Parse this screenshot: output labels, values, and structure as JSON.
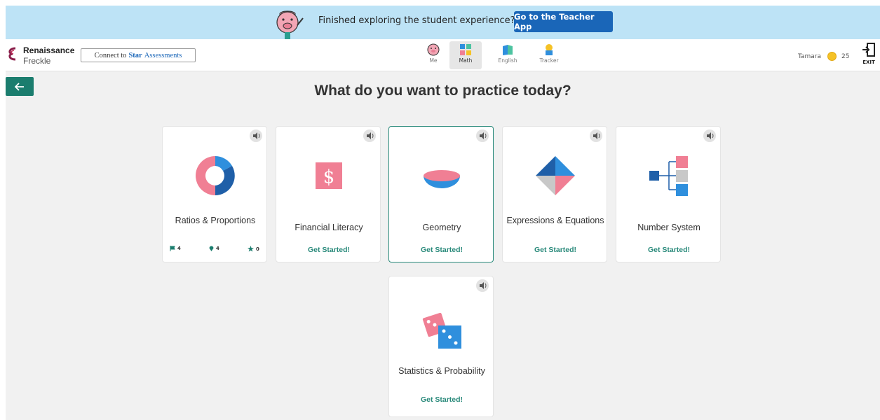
{
  "banner": {
    "message": "Finished exploring the student experience?",
    "button_label": "Go to the Teacher App"
  },
  "brand": {
    "line1": "Renaissance",
    "line2": "Freckle",
    "connect_prefix": "Connect to",
    "connect_star": "Star",
    "connect_suffix": "Assessments"
  },
  "nav": {
    "tabs": [
      {
        "label": "Me",
        "icon": "avatar-icon"
      },
      {
        "label": "Math",
        "icon": "math-blocks-icon"
      },
      {
        "label": "English",
        "icon": "book-icon"
      },
      {
        "label": "Tracker",
        "icon": "trophy-icon"
      }
    ],
    "active_tab": "Math"
  },
  "user": {
    "name": "Tamara",
    "coins": "25",
    "exit_label": "EXIT"
  },
  "page": {
    "heading": "What do you want to practice today?"
  },
  "cards": [
    {
      "title": "Ratios & Proportions",
      "icon": "donut-chart-icon",
      "stats": {
        "flags": "4",
        "pins": "4",
        "stars": "0"
      }
    },
    {
      "title": "Financial Literacy",
      "icon": "dollar-icon",
      "cta": "Get Started!"
    },
    {
      "title": "Geometry",
      "icon": "bowl-shape-icon",
      "cta": "Get Started!"
    },
    {
      "title": "Expressions & Equations",
      "icon": "diamond-shape-icon",
      "cta": "Get Started!"
    },
    {
      "title": "Number System",
      "icon": "tree-diagram-icon",
      "cta": "Get Started!"
    },
    {
      "title": "Statistics & Probability",
      "icon": "dice-icon",
      "cta": "Get Started!"
    }
  ],
  "colors": {
    "accent": "#2a8a7b",
    "banner_bg": "#bde3f6",
    "button_blue": "#1a66b8",
    "pink": "#f07f94",
    "blue": "#2f8fdd",
    "dark_blue": "#1f5fa8",
    "gray": "#c8c8c8"
  }
}
